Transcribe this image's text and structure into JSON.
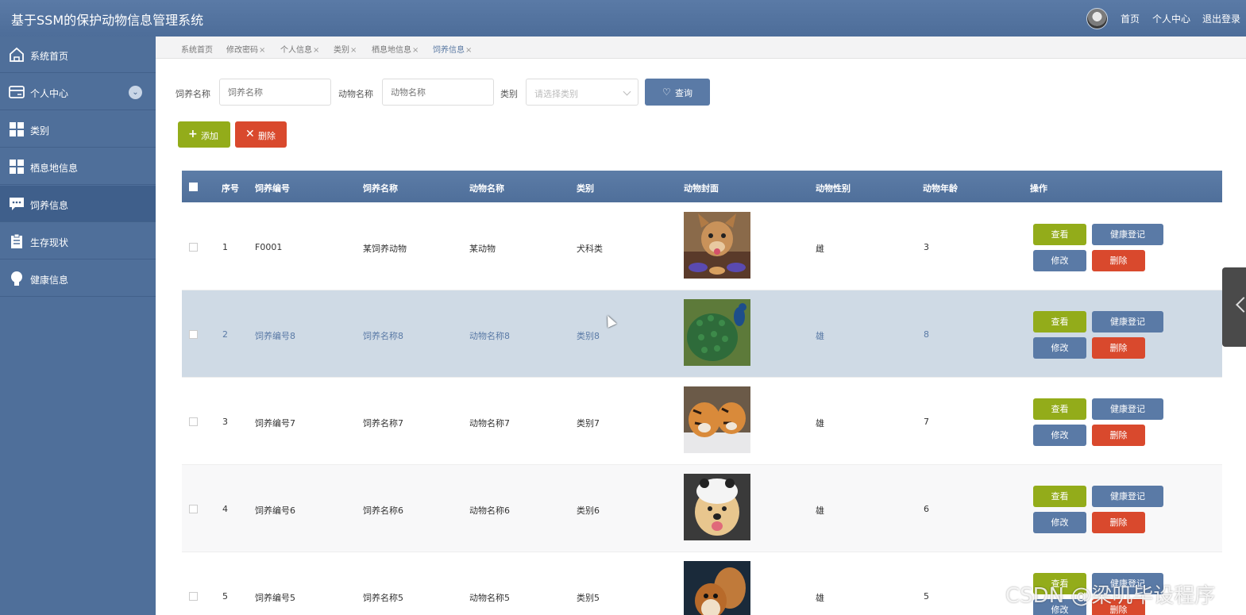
{
  "app": {
    "title": "基于SSM的保护动物信息管理系统"
  },
  "header_nav": {
    "home": "首页",
    "profile": "个人中心",
    "logout": "退出登录"
  },
  "sidebar": {
    "items": [
      {
        "label": "系统首页",
        "icon": "home-icon"
      },
      {
        "label": "个人中心",
        "icon": "card-icon"
      },
      {
        "label": "类别",
        "icon": "grid-icon"
      },
      {
        "label": "栖息地信息",
        "icon": "grid-icon"
      },
      {
        "label": "饲养信息",
        "icon": "chat-icon"
      },
      {
        "label": "生存现状",
        "icon": "clipboard-icon"
      },
      {
        "label": "健康信息",
        "icon": "bulb-icon"
      }
    ]
  },
  "tabs": [
    {
      "label": "系统首页",
      "closable": false
    },
    {
      "label": "修改密码",
      "closable": true
    },
    {
      "label": "个人信息",
      "closable": true
    },
    {
      "label": "类别",
      "closable": true
    },
    {
      "label": "栖息地信息",
      "closable": true
    },
    {
      "label": "饲养信息",
      "closable": true
    }
  ],
  "tab_close": "×",
  "search": {
    "feed_label": "饲养名称",
    "feed_placeholder": "饲养名称",
    "animal_label": "动物名称",
    "animal_placeholder": "动物名称",
    "category_label": "类别",
    "category_placeholder": "请选择类别",
    "query_button": "查询"
  },
  "toolbar": {
    "add_button": "添加",
    "delete_button": "删除"
  },
  "table": {
    "headers": [
      "序号",
      "饲养编号",
      "饲养名称",
      "动物名称",
      "类别",
      "动物封面",
      "动物性别",
      "动物年龄",
      "操作"
    ],
    "actions": {
      "view": "查看",
      "health": "健康登记",
      "edit": "修改",
      "delete": "删除"
    },
    "rows": [
      {
        "index": "1",
        "code": "F0001",
        "feed_name": "某饲养动物",
        "animal_name": "某动物",
        "category": "犬科类",
        "cover": "dog-eating",
        "gender": "雌",
        "age": "3"
      },
      {
        "index": "2",
        "code": "饲养编号8",
        "feed_name": "饲养名称8",
        "animal_name": "动物名称8",
        "category": "类别8",
        "cover": "peacock",
        "gender": "雄",
        "age": "8"
      },
      {
        "index": "3",
        "code": "饲养编号7",
        "feed_name": "饲养名称7",
        "animal_name": "动物名称7",
        "category": "类别7",
        "cover": "tigers",
        "gender": "雄",
        "age": "7"
      },
      {
        "index": "4",
        "code": "饲养编号6",
        "feed_name": "饲养名称6",
        "animal_name": "动物名称6",
        "category": "类别6",
        "cover": "puppy",
        "gender": "雄",
        "age": "6"
      },
      {
        "index": "5",
        "code": "饲养编号5",
        "feed_name": "饲养名称5",
        "animal_name": "动物名称5",
        "category": "类别5",
        "cover": "squirrel",
        "gender": "雄",
        "age": "5"
      }
    ]
  },
  "watermark": "CSDN @梁叽毕设程序",
  "colors": {
    "primary": "#5a7aa6",
    "success": "#93ac1a",
    "danger": "#d9492d",
    "sidebar": "#4f6f9a"
  }
}
